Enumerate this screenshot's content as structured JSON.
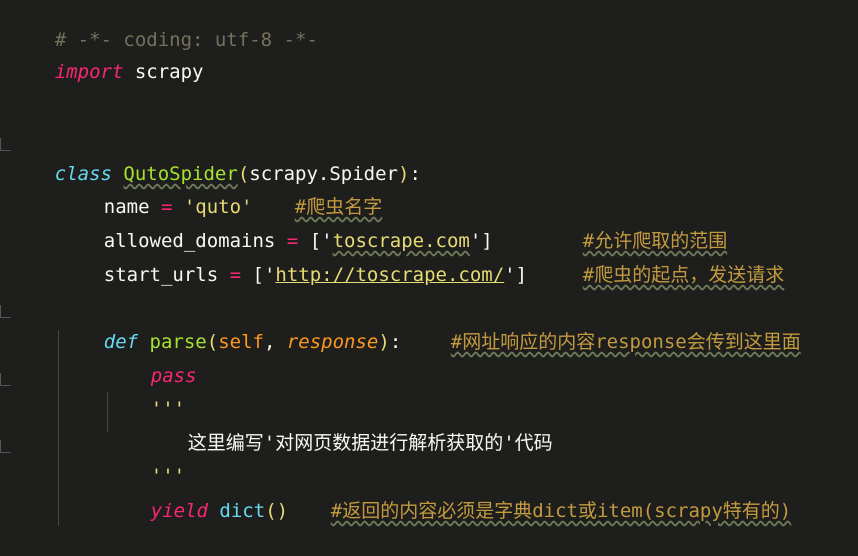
{
  "code": {
    "line1": "# -*- coding: utf-8 -*-",
    "line2_kw": "import",
    "line2_mod": " scrapy",
    "line5_kw": "class",
    "line5_name": "QutoSpider",
    "line5_paren_open": "(",
    "line5_base": "scrapy.Spider",
    "line5_paren_close": ")",
    "line5_colon": ":",
    "line6_var": "name ",
    "line6_eq": "=",
    "line6_str": " 'quto'",
    "line6_comment": "#爬虫名字",
    "line7_var": "allowed_domains ",
    "line7_eq": "=",
    "line7_open": " ['",
    "line7_str": "toscrape.com",
    "line7_close": "']",
    "line7_comment": "#允许爬取的范围",
    "line8_var": "start_urls ",
    "line8_eq": "=",
    "line8_open": " ['",
    "line8_str": "http://toscrape.com/",
    "line8_close": "']",
    "line8_comment": "#爬虫的起点，发送请求",
    "line10_kw": "def",
    "line10_name": "parse",
    "line10_open": "(",
    "line10_self": "self",
    "line10_comma": ", ",
    "line10_param": "response",
    "line10_close": ")",
    "line10_colon": ":",
    "line10_comment": "#网址响应的内容response会传到这里面",
    "line11_kw": "pass",
    "line12_quote": "'''",
    "line13_text": "这里编写'对网页数据进行解析获取的'代码",
    "line14_quote": "'''",
    "line15_kw": "yield",
    "line15_func": "dict",
    "line15_paren": "()",
    "line15_comment": "#返回的内容必须是字典dict或item(scrapy特有的)"
  },
  "colors": {
    "background": "#1e1f1c",
    "keyword": "#f92672",
    "keyword_blue": "#66d9ef",
    "string": "#e6db74",
    "class_name": "#a6e22e",
    "comment": "#75715e",
    "param": "#fd971f"
  }
}
